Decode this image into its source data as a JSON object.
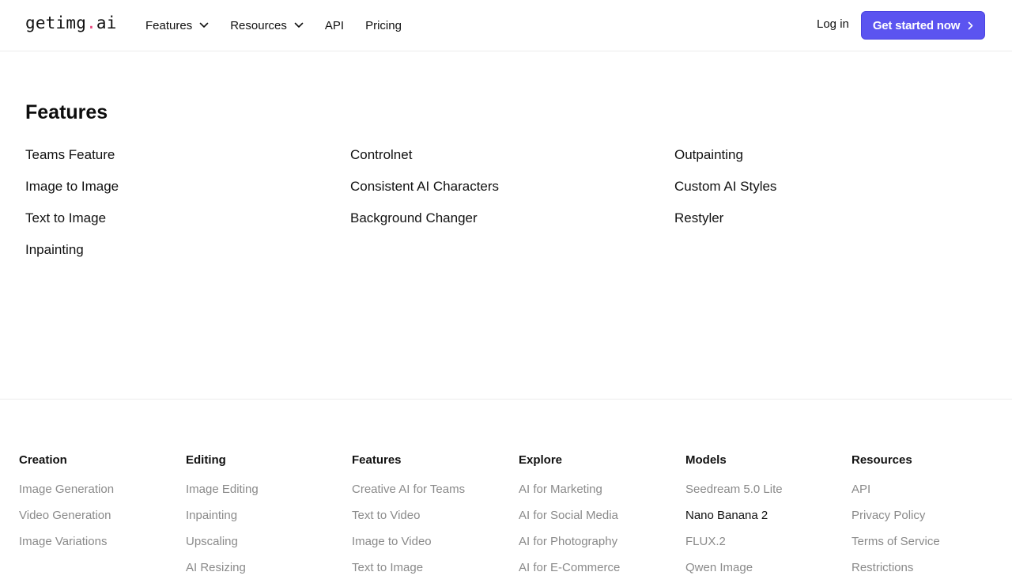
{
  "header": {
    "logo_pre": "getimg",
    "logo_dot": ".",
    "logo_post": "ai",
    "nav": [
      {
        "label": "Features",
        "has_dropdown": true,
        "icon": "chevron-down-icon"
      },
      {
        "label": "Resources",
        "has_dropdown": true,
        "icon": "chevron-down-icon"
      },
      {
        "label": "API",
        "has_dropdown": false
      },
      {
        "label": "Pricing",
        "has_dropdown": false
      }
    ],
    "login_label": "Log in",
    "cta_label": "Get started now",
    "cta_icon": "chevron-right-icon",
    "accent_color": "#5b54f0",
    "logo_dot_color": "#e8457d"
  },
  "features": {
    "title": "Features",
    "columns": [
      [
        "Teams Feature",
        "Image to Image",
        "Text to Image",
        "Inpainting"
      ],
      [
        "Controlnet",
        "Consistent AI Characters",
        "Background Changer"
      ],
      [
        "Outpainting",
        "Custom AI Styles",
        "Restyler"
      ]
    ]
  },
  "footer": {
    "columns": [
      {
        "heading": "Creation",
        "links": [
          "Image Generation",
          "Video Generation",
          "Image Variations"
        ]
      },
      {
        "heading": "Editing",
        "links": [
          "Image Editing",
          "Inpainting",
          "Upscaling",
          "AI Resizing"
        ]
      },
      {
        "heading": "Features",
        "links": [
          "Creative AI for Teams",
          "Text to Video",
          "Image to Video",
          "Text to Image"
        ]
      },
      {
        "heading": "Explore",
        "links": [
          "AI for Marketing",
          "AI for Social Media",
          "AI for Photography",
          "AI for E-Commerce"
        ]
      },
      {
        "heading": "Models",
        "links": [
          "Seedream 5.0 Lite",
          "Nano Banana 2",
          "FLUX.2",
          "Qwen Image"
        ]
      },
      {
        "heading": "Resources",
        "links": [
          "API",
          "Privacy Policy",
          "Terms of Service",
          "Restrictions"
        ]
      }
    ]
  }
}
